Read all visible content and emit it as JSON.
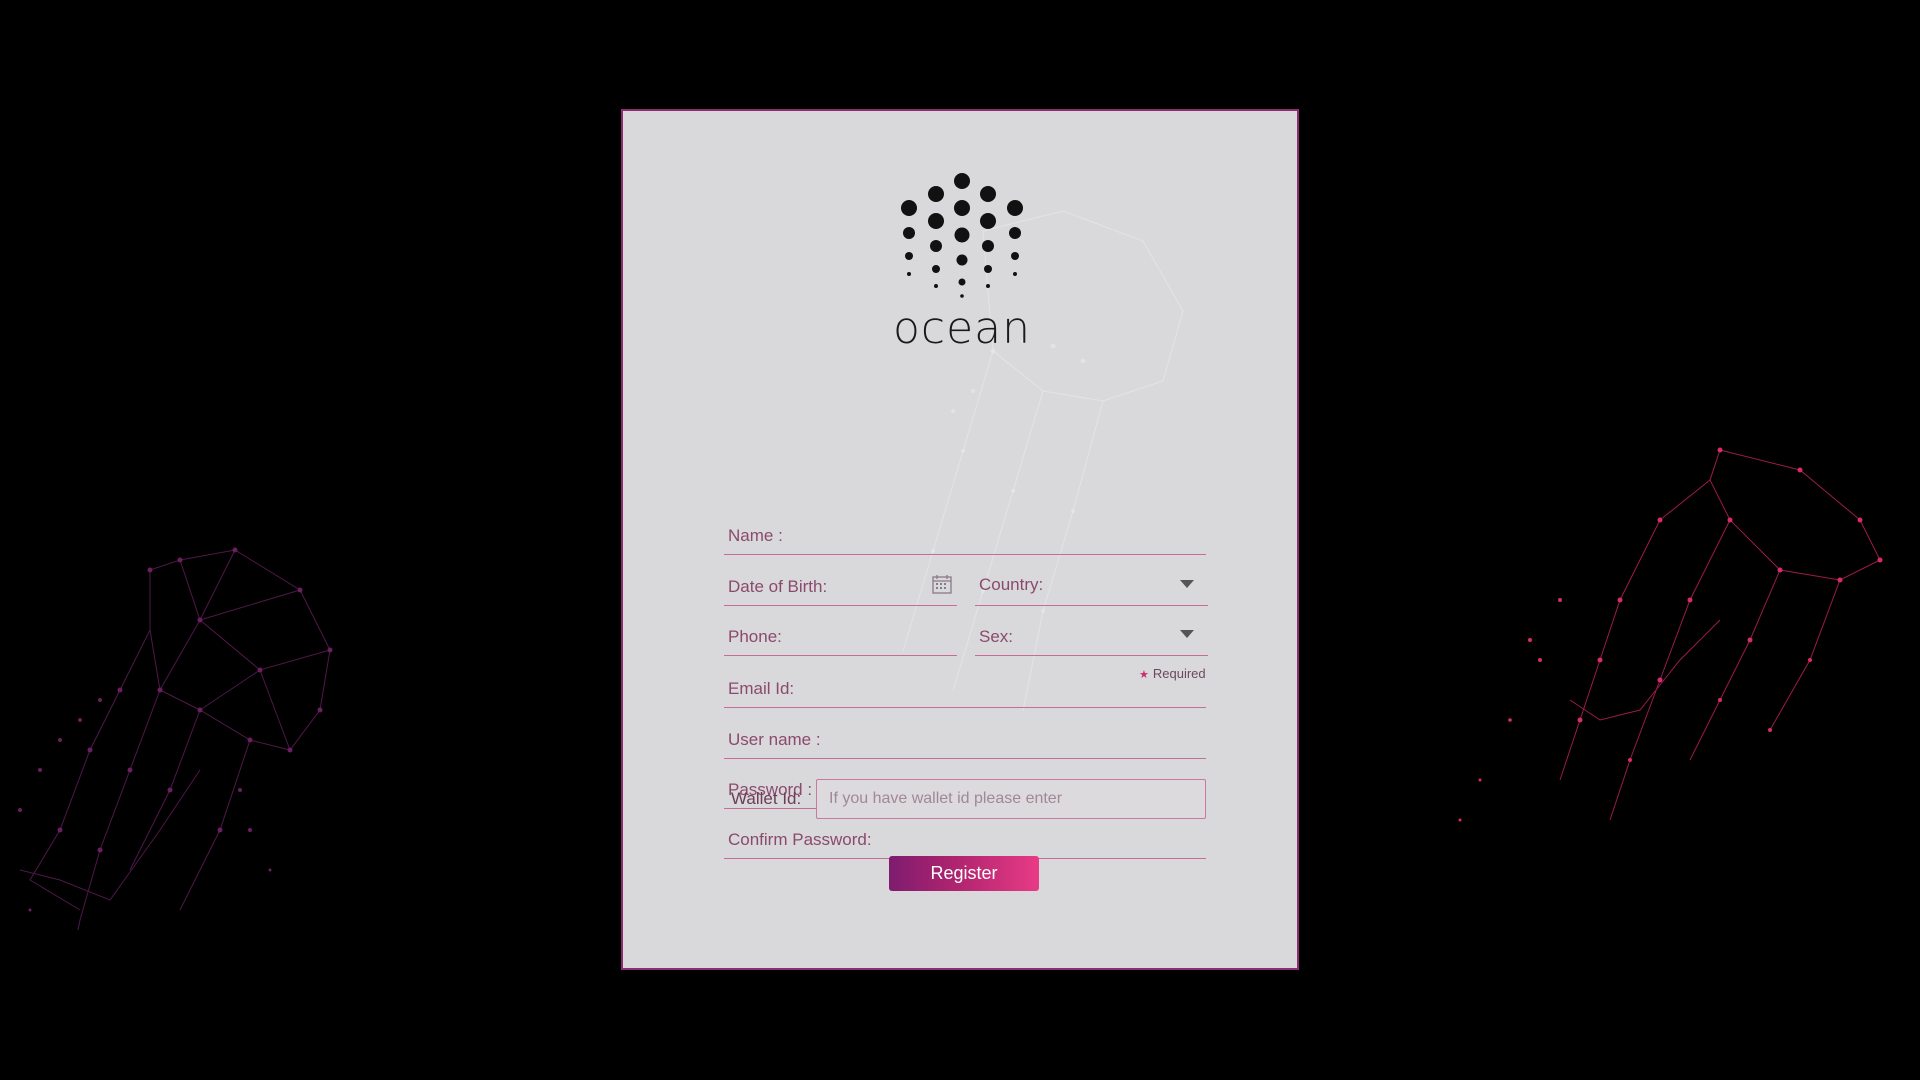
{
  "app": {
    "logo_text": "ocean",
    "accent_color": "#8e2c74",
    "button_gradient": [
      "#7e1c6f",
      "#e83b86"
    ]
  },
  "form": {
    "name_label": "Name :",
    "dob_label": "Date of Birth:",
    "country_label": "Country:",
    "phone_label": "Phone:",
    "sex_label": "Sex:",
    "required_note": "Required",
    "email_label": "Email Id:",
    "username_label": "User name :",
    "password_label": "Password :",
    "confirm_password_label": "Confirm Password:",
    "wallet_label": "Wallet Id:",
    "wallet_placeholder": "If you have wallet id please enter",
    "register_label": "Register"
  },
  "icons": {
    "calendar": "calendar-icon",
    "dropdown": "caret-down-icon",
    "required": "star-icon"
  }
}
